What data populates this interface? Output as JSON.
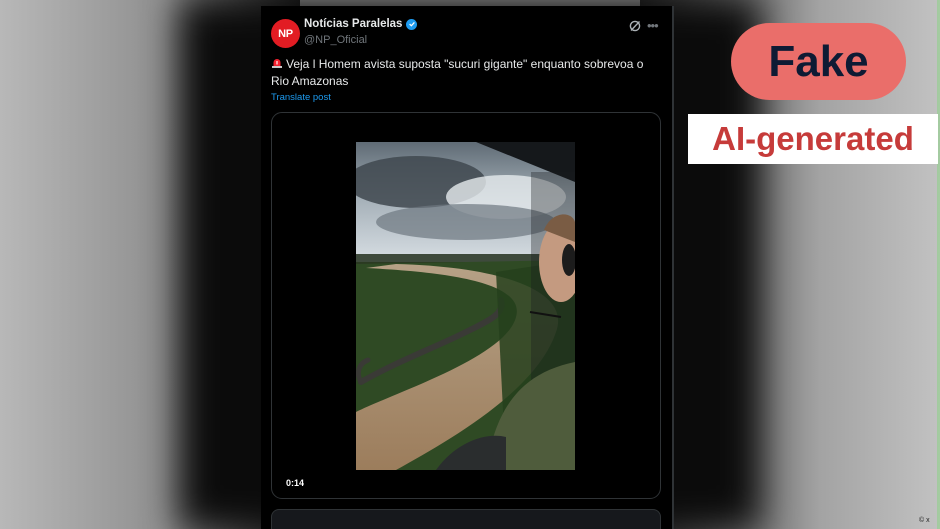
{
  "post": {
    "avatar_text": "NP",
    "author_name": "Notícias Paralelas",
    "handle": "@NP_Oficial",
    "text": "Veja l Homem avista suposta \"sucuri gigante\" enquanto sobrevoa o Rio Amazonas",
    "translate_label": "Translate post",
    "video_time": "0:14"
  },
  "labels": {
    "fake": "Fake",
    "ai_generated": "AI-generated",
    "credit": "© x"
  },
  "icons": {
    "verified": "verified-badge-icon",
    "grok": "grok-icon",
    "more": "more-icon",
    "siren": "siren-icon"
  },
  "colors": {
    "fake_pill": "#ea6e6a",
    "fake_text": "#0e1b34",
    "ai_text": "#c63b3a",
    "avatar": "#e21c23",
    "link": "#1d9bf0"
  }
}
